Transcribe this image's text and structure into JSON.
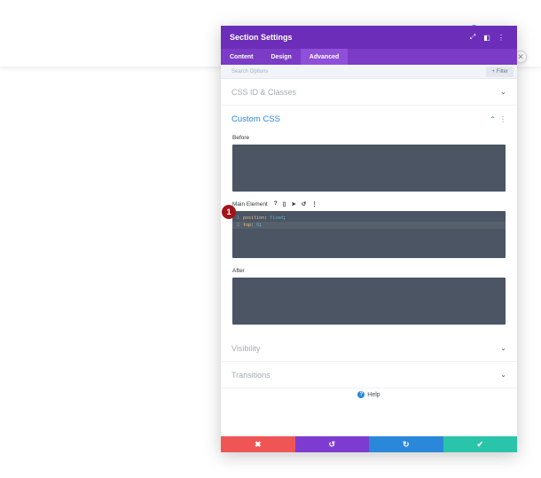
{
  "modal": {
    "title": "Section Settings",
    "header_icons": [
      "fullscreen-icon",
      "split-view-icon",
      "more-icon"
    ],
    "header_glyphs": [
      "⤢",
      "◧",
      "⋮"
    ]
  },
  "tabs": [
    {
      "label": "Content",
      "active": false
    },
    {
      "label": "Design",
      "active": false
    },
    {
      "label": "Advanced",
      "active": true
    }
  ],
  "search": {
    "placeholder": "Search Options",
    "filter_label": "+ Filter"
  },
  "toggles": {
    "css_id": "CSS ID & Classes",
    "custom_css": "Custom CSS",
    "visibility": "Visibility",
    "transitions": "Transitions"
  },
  "custom_css": {
    "before_label": "Before",
    "main_label": "Main Element",
    "main_tools": [
      "?",
      "▯",
      "➤",
      "↺",
      "⋮"
    ],
    "after_label": "After",
    "code": [
      {
        "num": "1",
        "prop": "position",
        "value": "fixed"
      },
      {
        "num": "2",
        "prop": "top",
        "value": "0"
      }
    ]
  },
  "badge": "1",
  "help_label": "Help",
  "footer": {
    "cancel": "✖",
    "undo": "↺",
    "redo": "↻",
    "save": "✔"
  },
  "colors": {
    "header": "#6c2eb9",
    "accent": "#2b87da",
    "cancel": "#ef5555",
    "undo": "#7e3bd0",
    "redo": "#2b87da",
    "save": "#29c4a9"
  }
}
